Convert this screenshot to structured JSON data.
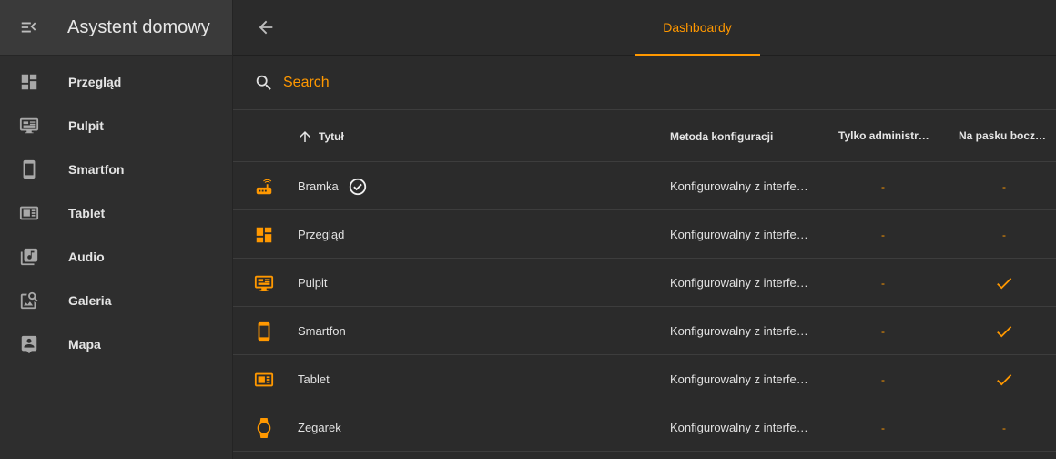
{
  "app": {
    "title": "Asystent domowy"
  },
  "sidebar": {
    "items": [
      {
        "label": "Przegląd",
        "icon": "dashboard-grid-icon"
      },
      {
        "label": "Pulpit",
        "icon": "monitor-icon"
      },
      {
        "label": "Smartfon",
        "icon": "smartphone-icon"
      },
      {
        "label": "Tablet",
        "icon": "tablet-icon"
      },
      {
        "label": "Audio",
        "icon": "music-library-icon"
      },
      {
        "label": "Galeria",
        "icon": "image-search-icon"
      },
      {
        "label": "Mapa",
        "icon": "map-person-icon"
      }
    ]
  },
  "topbar": {
    "tab_label": "Dashboardy"
  },
  "search": {
    "placeholder": "Search"
  },
  "table": {
    "columns": {
      "title": "Tytuł",
      "method": "Metoda konfiguracji",
      "admin": "Tylko administratorzy",
      "sidebar": "Na pasku bocznym"
    },
    "rows": [
      {
        "icon": "router-icon",
        "title": "Bramka",
        "default": true,
        "method": "Konfigurowalny z interfejsu",
        "admin": "-",
        "sidebar": "-"
      },
      {
        "icon": "dashboard-grid-icon",
        "title": "Przegląd",
        "default": false,
        "method": "Konfigurowalny z interfejsu",
        "admin": "-",
        "sidebar": "-"
      },
      {
        "icon": "monitor-icon",
        "title": "Pulpit",
        "default": false,
        "method": "Konfigurowalny z interfejsu",
        "admin": "-",
        "sidebar": "check"
      },
      {
        "icon": "smartphone-icon",
        "title": "Smartfon",
        "default": false,
        "method": "Konfigurowalny z interfejsu",
        "admin": "-",
        "sidebar": "check"
      },
      {
        "icon": "tablet-icon",
        "title": "Tablet",
        "default": false,
        "method": "Konfigurowalny z interfejsu",
        "admin": "-",
        "sidebar": "check"
      },
      {
        "icon": "watch-icon",
        "title": "Zegarek",
        "default": false,
        "method": "Konfigurowalny z interfejsu",
        "admin": "-",
        "sidebar": "-"
      }
    ]
  },
  "colors": {
    "accent": "#ff9800",
    "background": "#2b2b2b",
    "sidebar": "#2e2e2e"
  }
}
